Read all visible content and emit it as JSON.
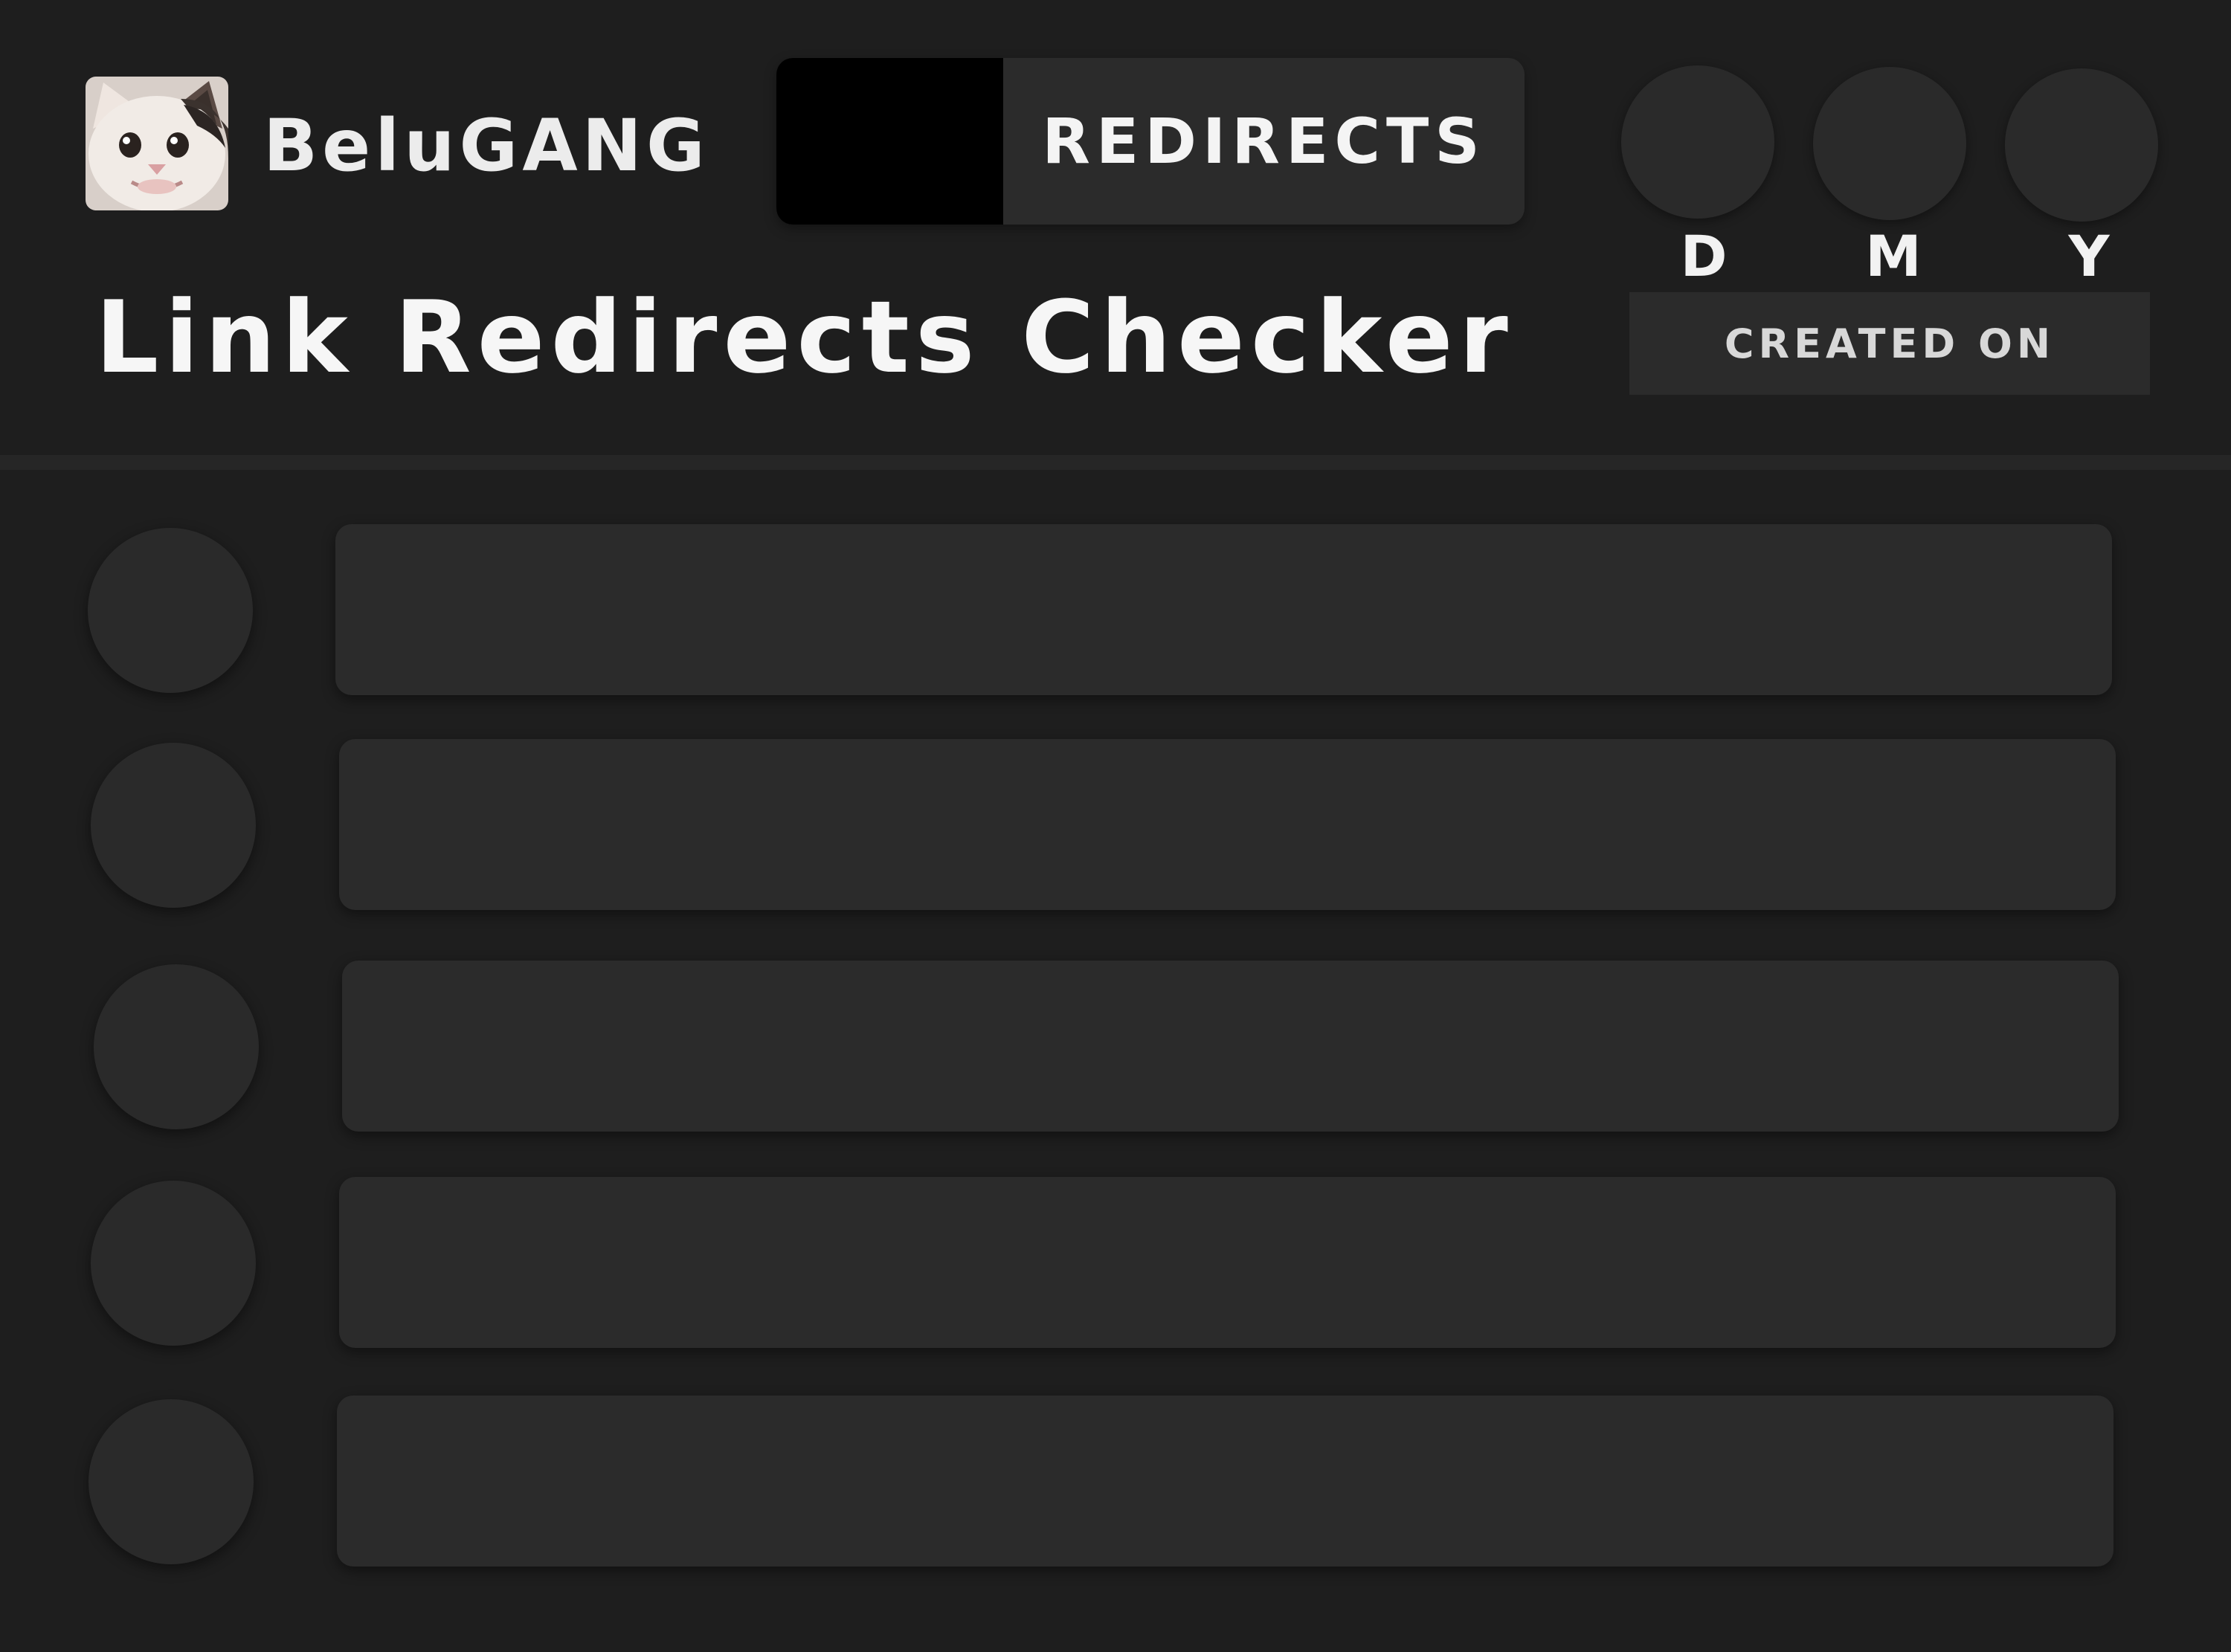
{
  "header": {
    "brand_name": "BeluGANG",
    "toggle_label": "REDIRECTS",
    "page_title": "Link Redirects Checker",
    "date_selector": {
      "day_label": "D",
      "month_label": "M",
      "year_label": "Y",
      "created_on_label": "CREATED ON"
    }
  },
  "colors": {
    "background": "#1e1e1e",
    "surface": "#2b2b2b",
    "toggle_knob": "#000000",
    "text": "#f2f2f2"
  },
  "icons": {
    "avatar": "cat-avatar-icon"
  },
  "link_list": {
    "rows": 5
  }
}
